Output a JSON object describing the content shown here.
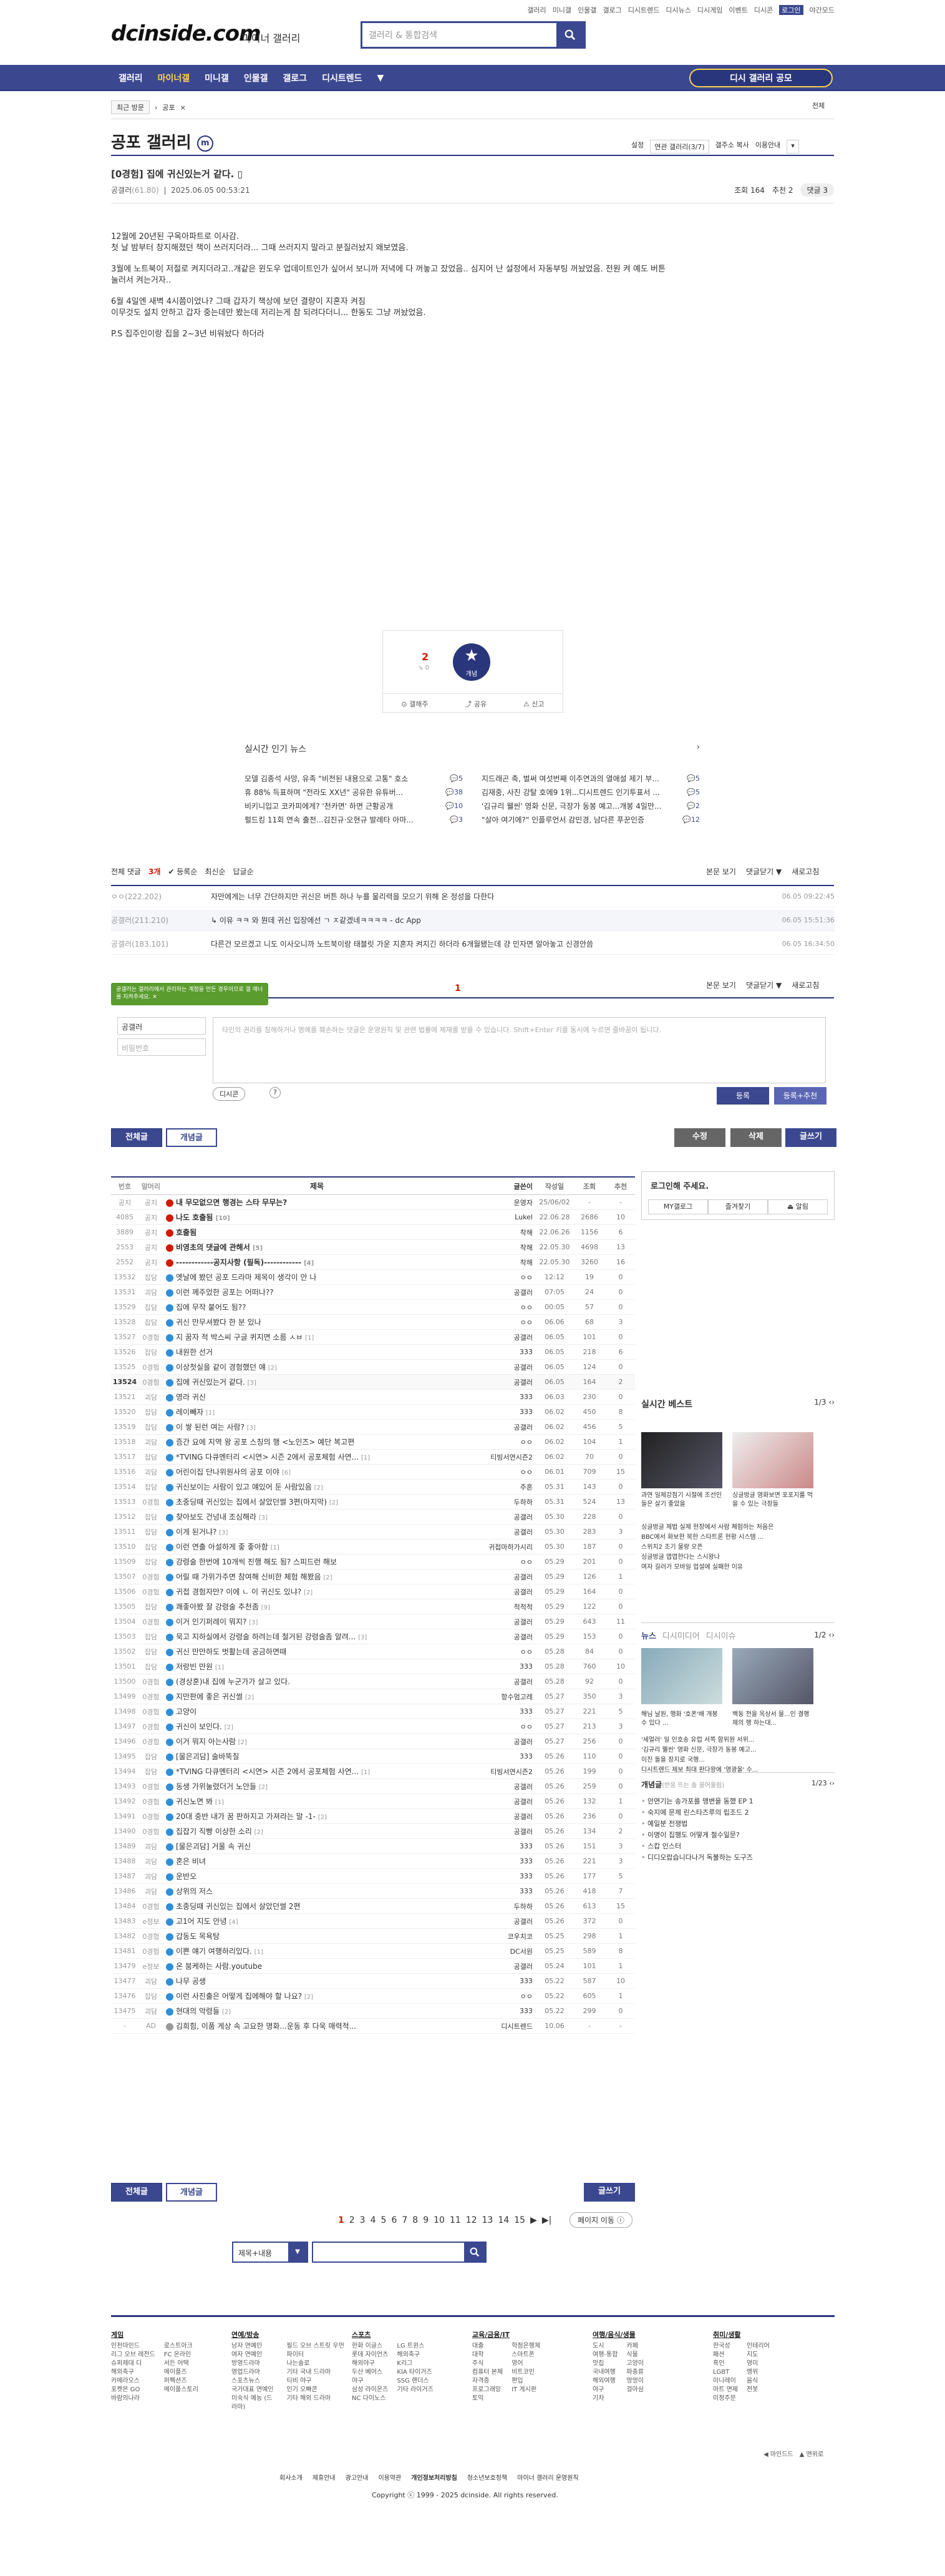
{
  "topbar": {
    "links": [
      "갤러리",
      "미니갤",
      "인물갤",
      "갤로그",
      "디시트렌드",
      "디시뉴스",
      "디시게임",
      "이벤트",
      "디시콘",
      "로그인",
      "야간모드"
    ]
  },
  "header": {
    "logo": "dcinside.com",
    "logo_sub": "마이너 갤러리",
    "search_placeholder": "갤러리 & 통합검색"
  },
  "gnb": {
    "items": [
      "갤러리",
      "마이너갤",
      "미니갤",
      "인물갤",
      "갤로그",
      "디시트렌드",
      "▼"
    ],
    "active": 1,
    "recruit": "디시 갤러리 공모"
  },
  "crumb": {
    "recent": "최근 방문",
    "cur": "공포",
    "more": "전체"
  },
  "gallery": {
    "title": "공포 갤러리",
    "badge": "ⓜ",
    "opts": [
      "설정",
      "연관 갤러리(3/7)",
      "갤주소 복사",
      "이용안내"
    ]
  },
  "post": {
    "title": "[0경험] 집에 귀신있는거 같다.",
    "author": "공갤러",
    "ip": "(61.80)",
    "date": "2025.06.05 00:53:21",
    "views": "조회 164",
    "reco": "추천 2",
    "comments": "댓글 3",
    "body": [
      "12월에 20년된 구옥아파트로 이사감.",
      "첫 날 밤부터 창지해졌던 책이 쓰러지더라... 그때 쓰러지지 말라고 분질러놨지 왜보였음.",
      "3월에 노트북이 저절로 켜지더라고..개같은 윈도우 업데이트인가 싶어서 보니까 저녁에 다 꺼놓고 잤었음.. 심지어 난 설정에서 자동부팅 꺼놨었음. 전원 켜 예도 버튼 눌러서 켜는거자..",
      "6월 4일엔 새벽 4시쯤이었나? 그때 갑자기 책상에 보던 결량이 지혼자 켜짐",
      "이무것도 설치 안하고 갑자 중는데만 봤는데 저리는게 참 되려다더니... 한동도 그냥 꺼놨었음.",
      "P.S 집주인이랑 집을 2~3년 비워놨다 하더라"
    ]
  },
  "recobox": {
    "num": "2",
    "sub": "0",
    "star_label": "개념",
    "buttons": [
      "갤해주",
      "공유",
      "신고"
    ]
  },
  "news": {
    "title": "실시간 인기 뉴스",
    "left": [
      {
        "t": "모델 김종석 사망, 유족 \"비전된 내용으로 고통\" 호소",
        "c": "5"
      },
      {
        "t": "휴 88% 득표하며 \"전라도 XX년\" 공유한 유튜버...",
        "c": "38"
      },
      {
        "t": "비키니입고 코카피에게? '천카면' 하면 근황공개",
        "c": "10"
      },
      {
        "t": "펄드킹 11회 연속 출전...김진규·오현규 발레타 아마...",
        "c": "3"
      }
    ],
    "right": [
      {
        "t": "지드래곤 축, 벌써 여섯번째 이주연과의 열애설 제기 부...",
        "c": "5"
      },
      {
        "t": "김재중, 사진 강탈 호에9 1위...디시트렌드 인기투표서 ...",
        "c": "5"
      },
      {
        "t": "'김규리 웰씬' 영화 신문, 극장가 동봉 예고...개봉 4일만...",
        "c": "2"
      },
      {
        "t": "\"살아 여기에?\" 인플루언서 감민경, 남다른 푸꾼인증",
        "c": "12"
      }
    ]
  },
  "comments": {
    "head": [
      "전체 댓글",
      "3개",
      "✔ 등록순",
      "최신순",
      "답글순"
    ],
    "head_r": [
      "본문 보기",
      "댓글닫기 ▼",
      "새로고침"
    ],
    "items": [
      {
        "w": "ㅇㅇ",
        "ip": "(222.202)",
        "t": "자만에게는 너무 간단하지만 귀신은 버튼 하나 누를 물리력을 모으기 위해 온 정성을 다한다",
        "d": "06.05 09:22:45"
      },
      {
        "w": "공갤러",
        "ip": "(211.210)",
        "t": "↳ 이유 ㅋㅋ 와 뭔데 귀신 입장에선 ㄱ ㅈ같겠네ㅋㅋㅋㅋ - dc App",
        "d": "06.05 15:51:36"
      },
      {
        "w": "공갤러",
        "ip": "(183.101)",
        "t": "다른건 모르겠고 니도 이사오니까 노트북이랑 태블릿 가운 지혼자 켜지긴 하더라 6개월됐는데 걍 민자면 알아놓고 신경안씀",
        "d": "06.05 16:34:50"
      }
    ]
  },
  "write": {
    "tip": "공갤러는 갤러리에서 관리하는 계정을 만든 경우이므로 갤 매너를 지켜주세요.",
    "user": "공갤러",
    "pass": "비밀번호",
    "placeholder": "타인의 권리를 침해하거나 명예를 훼손하는 댓글은 운영원칙 및 관련 법률에 제재를 받을 수 있습니다. Shift+Enter 키를 동시에 누르면 줄바꿈이 됩니다.",
    "dc": "디시콘",
    "reg": "등록",
    "reg2": "등록+추천",
    "page": "1",
    "help": "?"
  },
  "bbar": {
    "full": "전체글",
    "rec": "개념글",
    "edit": "수정",
    "del": "삭제",
    "write": "글쓰기"
  },
  "list": {
    "head": [
      "번호",
      "말머리",
      "제목",
      "글쓴이",
      "작성일",
      "조회",
      "추천"
    ],
    "rows": [
      [
        "공지",
        "공지",
        "내 무모없으면 행경는 스타 무무는?",
        "운영자",
        "25/06/02",
        "-",
        "-",
        "r",
        ""
      ],
      [
        "4085",
        "공지",
        "나도 호출됨",
        "Lukel",
        "22.06.28",
        "2686",
        "10",
        "r",
        "[10]"
      ],
      [
        "3889",
        "공지",
        "호출됨",
        "착해",
        "22.06.26",
        "1156",
        "6",
        "r",
        ""
      ],
      [
        "2553",
        "공지",
        "비영초의 댓글에 관해서",
        "착해",
        "22.05.30",
        "4698",
        "13",
        "r",
        "[5]"
      ],
      [
        "2552",
        "공지",
        "------------공지사항 (필독)------------",
        "착해",
        "22.05.30",
        "3260",
        "16",
        "r",
        "[4]"
      ],
      [
        "13532",
        "잡담",
        "옛날에 봤던 공포 드라마 제목이 생각이 안 나",
        "ㅇㅇ",
        "12:12",
        "19",
        "0",
        "b",
        ""
      ],
      [
        "13531",
        "괴담",
        "이런 께주었한 공포는 어떠나??",
        "공갤러",
        "07:05",
        "24",
        "0",
        "b",
        ""
      ],
      [
        "13529",
        "잡담",
        "집에 무작 붙어도 됨??",
        "ㅇㅇ",
        "00:05",
        "57",
        "0",
        "b",
        ""
      ],
      [
        "13528",
        "잡담",
        "귀신 만무셔봤다 한 분 있나",
        "ㅇㅇ",
        "06.06",
        "68",
        "3",
        "b",
        ""
      ],
      [
        "13527",
        "0경험",
        "지 꿈자 적 박스씨 구글 퀴지면 소름 ㅅㅂ",
        "공갤러",
        "06.05",
        "101",
        "0",
        "b",
        "[1]"
      ],
      [
        "13526",
        "잡담",
        "내원한 선거",
        "333",
        "06.05",
        "218",
        "6",
        "b",
        ""
      ],
      [
        "13525",
        "0경험",
        "이상첫실을 같이 경험했던 얘",
        "공갤러",
        "06.05",
        "124",
        "0",
        "b",
        "[2]"
      ],
      [
        "13524",
        "0경험",
        "집에 귀신있는거 같다.",
        "공갤러",
        "06.05",
        "164",
        "2",
        "b",
        "[3]"
      ],
      [
        "13521",
        "괴담",
        "영라 귀신",
        "333",
        "06.03",
        "230",
        "0",
        "b",
        ""
      ],
      [
        "13520",
        "잡담",
        "레이빼자",
        "333",
        "06.02",
        "450",
        "8",
        "b",
        "[1]"
      ],
      [
        "13519",
        "잡담",
        "이 쌓 된런 여는 사람?",
        "공갤러",
        "06.02",
        "456",
        "5",
        "b",
        "[3]"
      ],
      [
        "13518",
        "괴담",
        "증간 요에 지역 왕 공포 스칭의 행 <노인즈> 예단 복고편",
        "ㅇㅇ",
        "06.02",
        "104",
        "1",
        "b",
        ""
      ],
      [
        "13517",
        "잡담",
        "*TVING 다큐멘터리 <시연> 시즌 2에서 공포체험 사연...",
        "티빙서연시즌2",
        "06.02",
        "70",
        "0",
        "b",
        "[1]"
      ],
      [
        "13516",
        "괴담",
        "어린이집 단나위원사의 공포 이야",
        "ㅇㅇ",
        "06.01",
        "709",
        "15",
        "b",
        "[6]"
      ],
      [
        "13514",
        "잡담",
        "귀신보이는 사람이 있고 얘있어 둔 사람있음",
        "주혼",
        "05.31",
        "143",
        "0",
        "b",
        "[2]"
      ],
      [
        "13513",
        "0경험",
        "초중딩때 귀신있는 집에서 살았던썰 3편(마지막)",
        "두하하",
        "05.31",
        "524",
        "13",
        "b",
        "[2]"
      ],
      [
        "13512",
        "잡담",
        "찾아보도 건넝내 조심해라",
        "공갤러",
        "05.30",
        "228",
        "0",
        "b",
        "[3]"
      ],
      [
        "13511",
        "잡담",
        "이게 된거냐?",
        "공갤러",
        "05.30",
        "283",
        "3",
        "b",
        "[3]"
      ],
      [
        "13510",
        "잡담",
        "이런 연출 아설하게 좋 좋아함",
        "귀접마하가시리",
        "05.30",
        "187",
        "0",
        "b",
        "[1]"
      ],
      [
        "13509",
        "잡담",
        "강령술 한번에 10개씩 진행 해도 됨? 스피드런 해보",
        "ㅇㅇ",
        "05.29",
        "201",
        "0",
        "b",
        ""
      ],
      [
        "13507",
        "0경험",
        "어릴 때 가위가주면 참여해 신비한 체험 해봤음",
        "공갤러",
        "05.29",
        "126",
        "1",
        "b",
        "[2]"
      ],
      [
        "13506",
        "0경험",
        "귀접 경험자만? 이에 ㄴ 이 귀신도 있냐?",
        "공갤러",
        "05.29",
        "164",
        "0",
        "b",
        "[2]"
      ],
      [
        "13505",
        "잡담",
        "쾌좋아봤 잘 강령술 추천좀",
        "적적적",
        "05.29",
        "122",
        "0",
        "b",
        "[9]"
      ],
      [
        "13504",
        "0경험",
        "이거 인기퍼레이 뭐지?",
        "공갤러",
        "05.29",
        "643",
        "11",
        "b",
        "[3]"
      ],
      [
        "13503",
        "잡담",
        "묵고 지하실에서 강령술 하려는데 철거된 강령술좀 알려...",
        "공갤러",
        "05.29",
        "153",
        "0",
        "b",
        "[3]"
      ],
      [
        "13502",
        "잡담",
        "귀신 만만하도 벗활는데 공금하면때",
        "ㅇㅇ",
        "05.28",
        "84",
        "0",
        "b",
        ""
      ],
      [
        "13501",
        "잡담",
        "저랑빈 만원",
        "333",
        "05.28",
        "760",
        "10",
        "b",
        "[1]"
      ],
      [
        "13500",
        "0경험",
        "(경상훈)내 집에 누군가가 살고 있다.",
        "공갤러",
        "05.28",
        "92",
        "0",
        "b",
        ""
      ],
      [
        "13499",
        "0경험",
        "지만판에 좋은 귀신썰",
        "항수멈고레",
        "05.27",
        "350",
        "3",
        "b",
        "[2]"
      ],
      [
        "13498",
        "0경험",
        "고양이",
        "333",
        "05.27",
        "221",
        "5",
        "b",
        ""
      ],
      [
        "13497",
        "0경험",
        "귀신이 보인다.",
        "ㅇㅇ",
        "05.27",
        "213",
        "3",
        "b",
        "[2]"
      ],
      [
        "13496",
        "0경험",
        "이거 뭐지 아는사람",
        "공갤러",
        "05.27",
        "256",
        "0",
        "b",
        "[2]"
      ],
      [
        "13495",
        "잡담",
        "[물은괴담] 술바뚝질",
        "333",
        "05.26",
        "110",
        "0",
        "b",
        ""
      ],
      [
        "13494",
        "잡담",
        "*TVING 다큐멘터리 <시연> 시즌 2에서 공포체험 사연...",
        "티빙서연시즌2",
        "05.26",
        "199",
        "0",
        "b",
        "[1]"
      ],
      [
        "13493",
        "0경험",
        "동생 가위눌렸더거 노안들",
        "공갤러",
        "05.26",
        "259",
        "0",
        "b",
        "[2]"
      ],
      [
        "13492",
        "0경험",
        "귀신노면 봐",
        "공갤러",
        "05.26",
        "132",
        "1",
        "b",
        "[1]"
      ],
      [
        "13491",
        "0경험",
        "20대 중반 내가 꿈 판하지고 가져라는 말 -1-",
        "공갤러",
        "05.26",
        "236",
        "0",
        "b",
        "[2]"
      ],
      [
        "13490",
        "0경험",
        "집잡기 직빵 이상한 소리",
        "공갤러",
        "05.26",
        "134",
        "2",
        "b",
        "[2]"
      ],
      [
        "13489",
        "괴담",
        "[물은괴담] 거울 속 귀신",
        "333",
        "05.26",
        "151",
        "3",
        "b",
        ""
      ],
      [
        "13488",
        "괴담",
        "혼은 비녀",
        "333",
        "05.26",
        "221",
        "3",
        "b",
        ""
      ],
      [
        "13487",
        "괴담",
        "운반오",
        "333",
        "05.26",
        "177",
        "5",
        "b",
        ""
      ],
      [
        "13486",
        "괴담",
        "상위의 저스",
        "333",
        "05.26",
        "418",
        "7",
        "b",
        ""
      ],
      [
        "13484",
        "0경험",
        "초중딩때 귀신있는 집에서 살았던썰 2편",
        "두하하",
        "05.26",
        "613",
        "15",
        "b",
        ""
      ],
      [
        "13483",
        "e정보",
        "고1어 지도 안녕",
        "공갤러",
        "05.26",
        "372",
        "0",
        "b",
        "[4]"
      ],
      [
        "13482",
        "0경험",
        "갑동도 목욕탕",
        "코우치코",
        "05.25",
        "298",
        "1",
        "b",
        ""
      ],
      [
        "13481",
        "0경험",
        "이쁜 얘기 여행하리있다.",
        "DC서원",
        "05.25",
        "589",
        "8",
        "b",
        "[1]"
      ],
      [
        "13479",
        "e정보",
        "온 붐케하는 사람.youtube",
        "공갤러",
        "05.24",
        "101",
        "1",
        "b",
        ""
      ],
      [
        "13477",
        "괴담",
        "나무 공생",
        "333",
        "05.22",
        "587",
        "10",
        "b",
        ""
      ],
      [
        "13476",
        "잡담",
        "이런 사진출은 어떻게 집에해야 할 나요?",
        "ㅇㅇ",
        "05.22",
        "605",
        "1",
        "b",
        "[2]"
      ],
      [
        "13475",
        "괴담",
        "현대의 악령들",
        "333",
        "05.22",
        "299",
        "0",
        "b",
        "[2]"
      ],
      [
        "-",
        "AD",
        "김희힘, 이품 게상 속 고요한 명화...운동 후 다욱 매력적...",
        "디시트렌드",
        "10.06",
        "-",
        "-",
        "g",
        ""
      ]
    ]
  },
  "login": {
    "h": "로그인해 주세요.",
    "b": [
      "MY갤로그",
      "즐겨찾기",
      "⏏ 알림"
    ]
  },
  "best": {
    "h": "실시간 베스트",
    "pg": "1/3",
    "cap": [
      "과연 일제강점기 시절에 조선인들은 살기 좋았을",
      "싱글벙글 영화보면 포포지를 먹을 수 있는 극장들"
    ],
    "ul": [
      "싱글벙글 제법 실제 현장에서 사람 체험하는 처음은",
      "BBC에서 화보한 북한 스타트론 현황 시스템 ...",
      "스위치2 조기 물량 오픈",
      "싱글벙글 엽엽한다는 스시왕나",
      "여자 길러가 모바일 업설에 실패한 이유"
    ]
  },
  "newsb": {
    "tabs": [
      "뉴스",
      "디시미디어",
      "디시이슈"
    ],
    "pg": "1/2",
    "cap": [
      "해님 날원, 행화 '호폰'배 개봉 수 있다 ...",
      "백동 전을 옥상서 물...인 결행 제의 행 하는대..."
    ],
    "ul": [
      "'세얼러' 일 인호송 유럽 서쪽 함위원 서위...",
      "'김규리 웰씬' 영화 신문, 극장가 동봉 예고...",
      "이진 돌을 장지로 국행...",
      "디시트렌드 제보 최대 판다왕에 '영광을' 수..."
    ]
  },
  "issue": {
    "h": "개념글",
    "sub": "(반응 뜨는 솔 끌어올림)",
    "pg": "1/23",
    "ul": [
      "안면기는 송가포를 맹변을 동했 EP 1",
      "숙지에 문제 린스타즈루의 립조드 2",
      "예일분 전쟁법",
      "이명이 집행도 어떻게 철수일문?",
      "스캅 인스터",
      "디디오랍습니다나거 독불하는 도구즈"
    ]
  },
  "pager": {
    "pages": [
      "1",
      "2",
      "3",
      "4",
      "5",
      "6",
      "7",
      "8",
      "9",
      "10",
      "11",
      "12",
      "13",
      "14",
      "15",
      "▶",
      "▶|"
    ],
    "go": "페이지 이동 ⓘ"
  },
  "bsearch": {
    "sel": "제목+내용",
    "arrow": "▼"
  },
  "footer": {
    "cols": [
      {
        "h": "게임",
        "l": [
          "인천마인드",
          "리그 오브 레전드",
          "슈퍼제대 디",
          "해외축구",
          "카메라오스",
          "포켓몬 GO",
          "바람의나라",
          "로스트아크",
          "FC 온라인",
          "서든 어택",
          "메이플즈",
          "퍼펙션즈",
          "메이플스토리"
        ]
      },
      {
        "h": "연예/방송",
        "l": [
          "남자 연예인",
          "여자 연예인",
          "방영드라마",
          "영업드라마",
          "스포츠뉴스",
          "국가대표 연예인",
          "미숙식 예능 (드라마)",
          "필드 오브 스트릿 우먼 파이터",
          "나는솔로",
          "기타 국내 드라마",
          "티비 야구",
          "인기 오빠콘",
          "기타 해외 드라마"
        ]
      },
      {
        "h": "스포츠",
        "l": [
          "한화 이글스",
          "롯데 자이언츠",
          "해외야구",
          "두산 베어스",
          "야구",
          "삼성 라이온즈",
          "NC 다이노스",
          "LG 트윈스",
          "해외축구",
          "K리그",
          "KIA 타이거즈",
          "SSG 랜더스",
          "기타 라이거즈"
        ]
      },
      {
        "h": "교육/금융/IT",
        "l": [
          "대출",
          "대학",
          "주식",
          "컴퓨터 본체",
          "자격증",
          "프로그래밍",
          "토익",
          "학점은행제",
          "스마트폰",
          "영어",
          "비트코인",
          "편입",
          "IT 게시판"
        ]
      },
      {
        "h": "여행/음식/생물",
        "l": [
          "도시",
          "여행-통합",
          "맛집",
          "국내여행",
          "해외여행",
          "야구",
          "기차",
          "카페",
          "식물",
          "고양이",
          "파충류",
          "멍멍이",
          "걸아삼"
        ]
      },
      {
        "h": "취미/생활",
        "l": [
          "한국성",
          "패션",
          "흑인",
          "LGBT",
          "미니레이",
          "아트 면제",
          "미정주문",
          "인테리어",
          "지도",
          "영미",
          "맹위",
          "음식",
          "전봇"
        ]
      }
    ],
    "links": [
      "회사소개",
      "제휴안내",
      "광고안내",
      "이용약관",
      "개인정보처리방침",
      "청소년보호정책",
      "마이너 갤러리 운영원칙"
    ],
    "copy": "Copyright ⓒ 1999 - 2025 dcinside. All rights reserved.",
    "arr": [
      "◀ 마인드드",
      "▲ 맨위로"
    ]
  }
}
